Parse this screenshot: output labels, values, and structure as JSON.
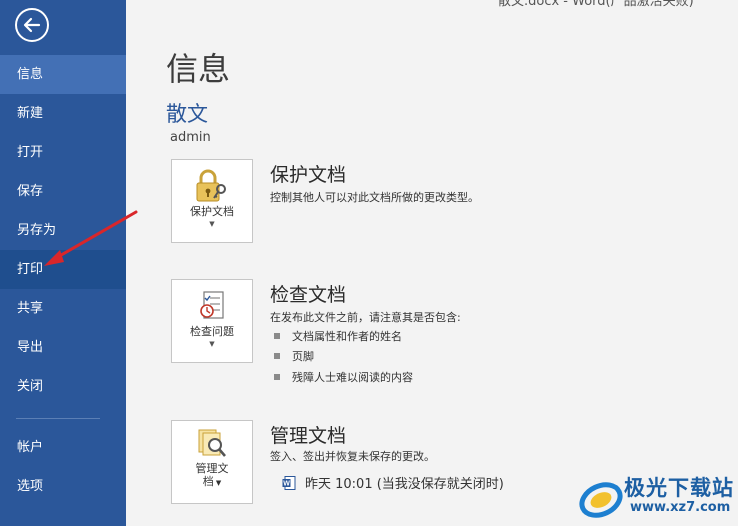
{
  "window": {
    "title": "散文.docx - Word(产品激活失败)"
  },
  "sidebar": {
    "back_icon": "back-arrow-icon",
    "items": [
      {
        "label": "信息",
        "state": "active"
      },
      {
        "label": "新建"
      },
      {
        "label": "打开"
      },
      {
        "label": "保存"
      },
      {
        "label": "另存为"
      },
      {
        "label": "打印",
        "state": "hover"
      },
      {
        "label": "共享"
      },
      {
        "label": "导出"
      },
      {
        "label": "关闭"
      },
      {
        "label": "帐户"
      },
      {
        "label": "选项"
      }
    ],
    "bg_color": "#2b579a",
    "active_color": "#4370b5"
  },
  "main": {
    "title": "信息",
    "doc_name": "散文",
    "author": "admin",
    "accent_color": "#2b579a",
    "sections": [
      {
        "button_label": "保护文档",
        "icon": "lock-key-icon",
        "title": "保护文档",
        "desc": "控制其他人可以对此文档所做的更改类型。"
      },
      {
        "button_label": "检查问题",
        "icon": "checklist-icon",
        "title": "检查文档",
        "desc": "在发布此文件之前，请注意其是否包含:",
        "bullets": [
          "文档属性和作者的姓名",
          "页脚",
          "残障人士难以阅读的内容"
        ]
      },
      {
        "button_label_line1": "管理文",
        "button_label_line2": "档",
        "icon": "manage-documents-icon",
        "title": "管理文档",
        "desc": "签入、签出并恢复未保存的更改。",
        "version": "昨天 10:01 (当我没保存就关闭时)"
      }
    ]
  },
  "annotation": {
    "arrow_color": "#d9262a"
  },
  "watermark": {
    "text": "极光下载站",
    "url": "www.xz7.com"
  }
}
